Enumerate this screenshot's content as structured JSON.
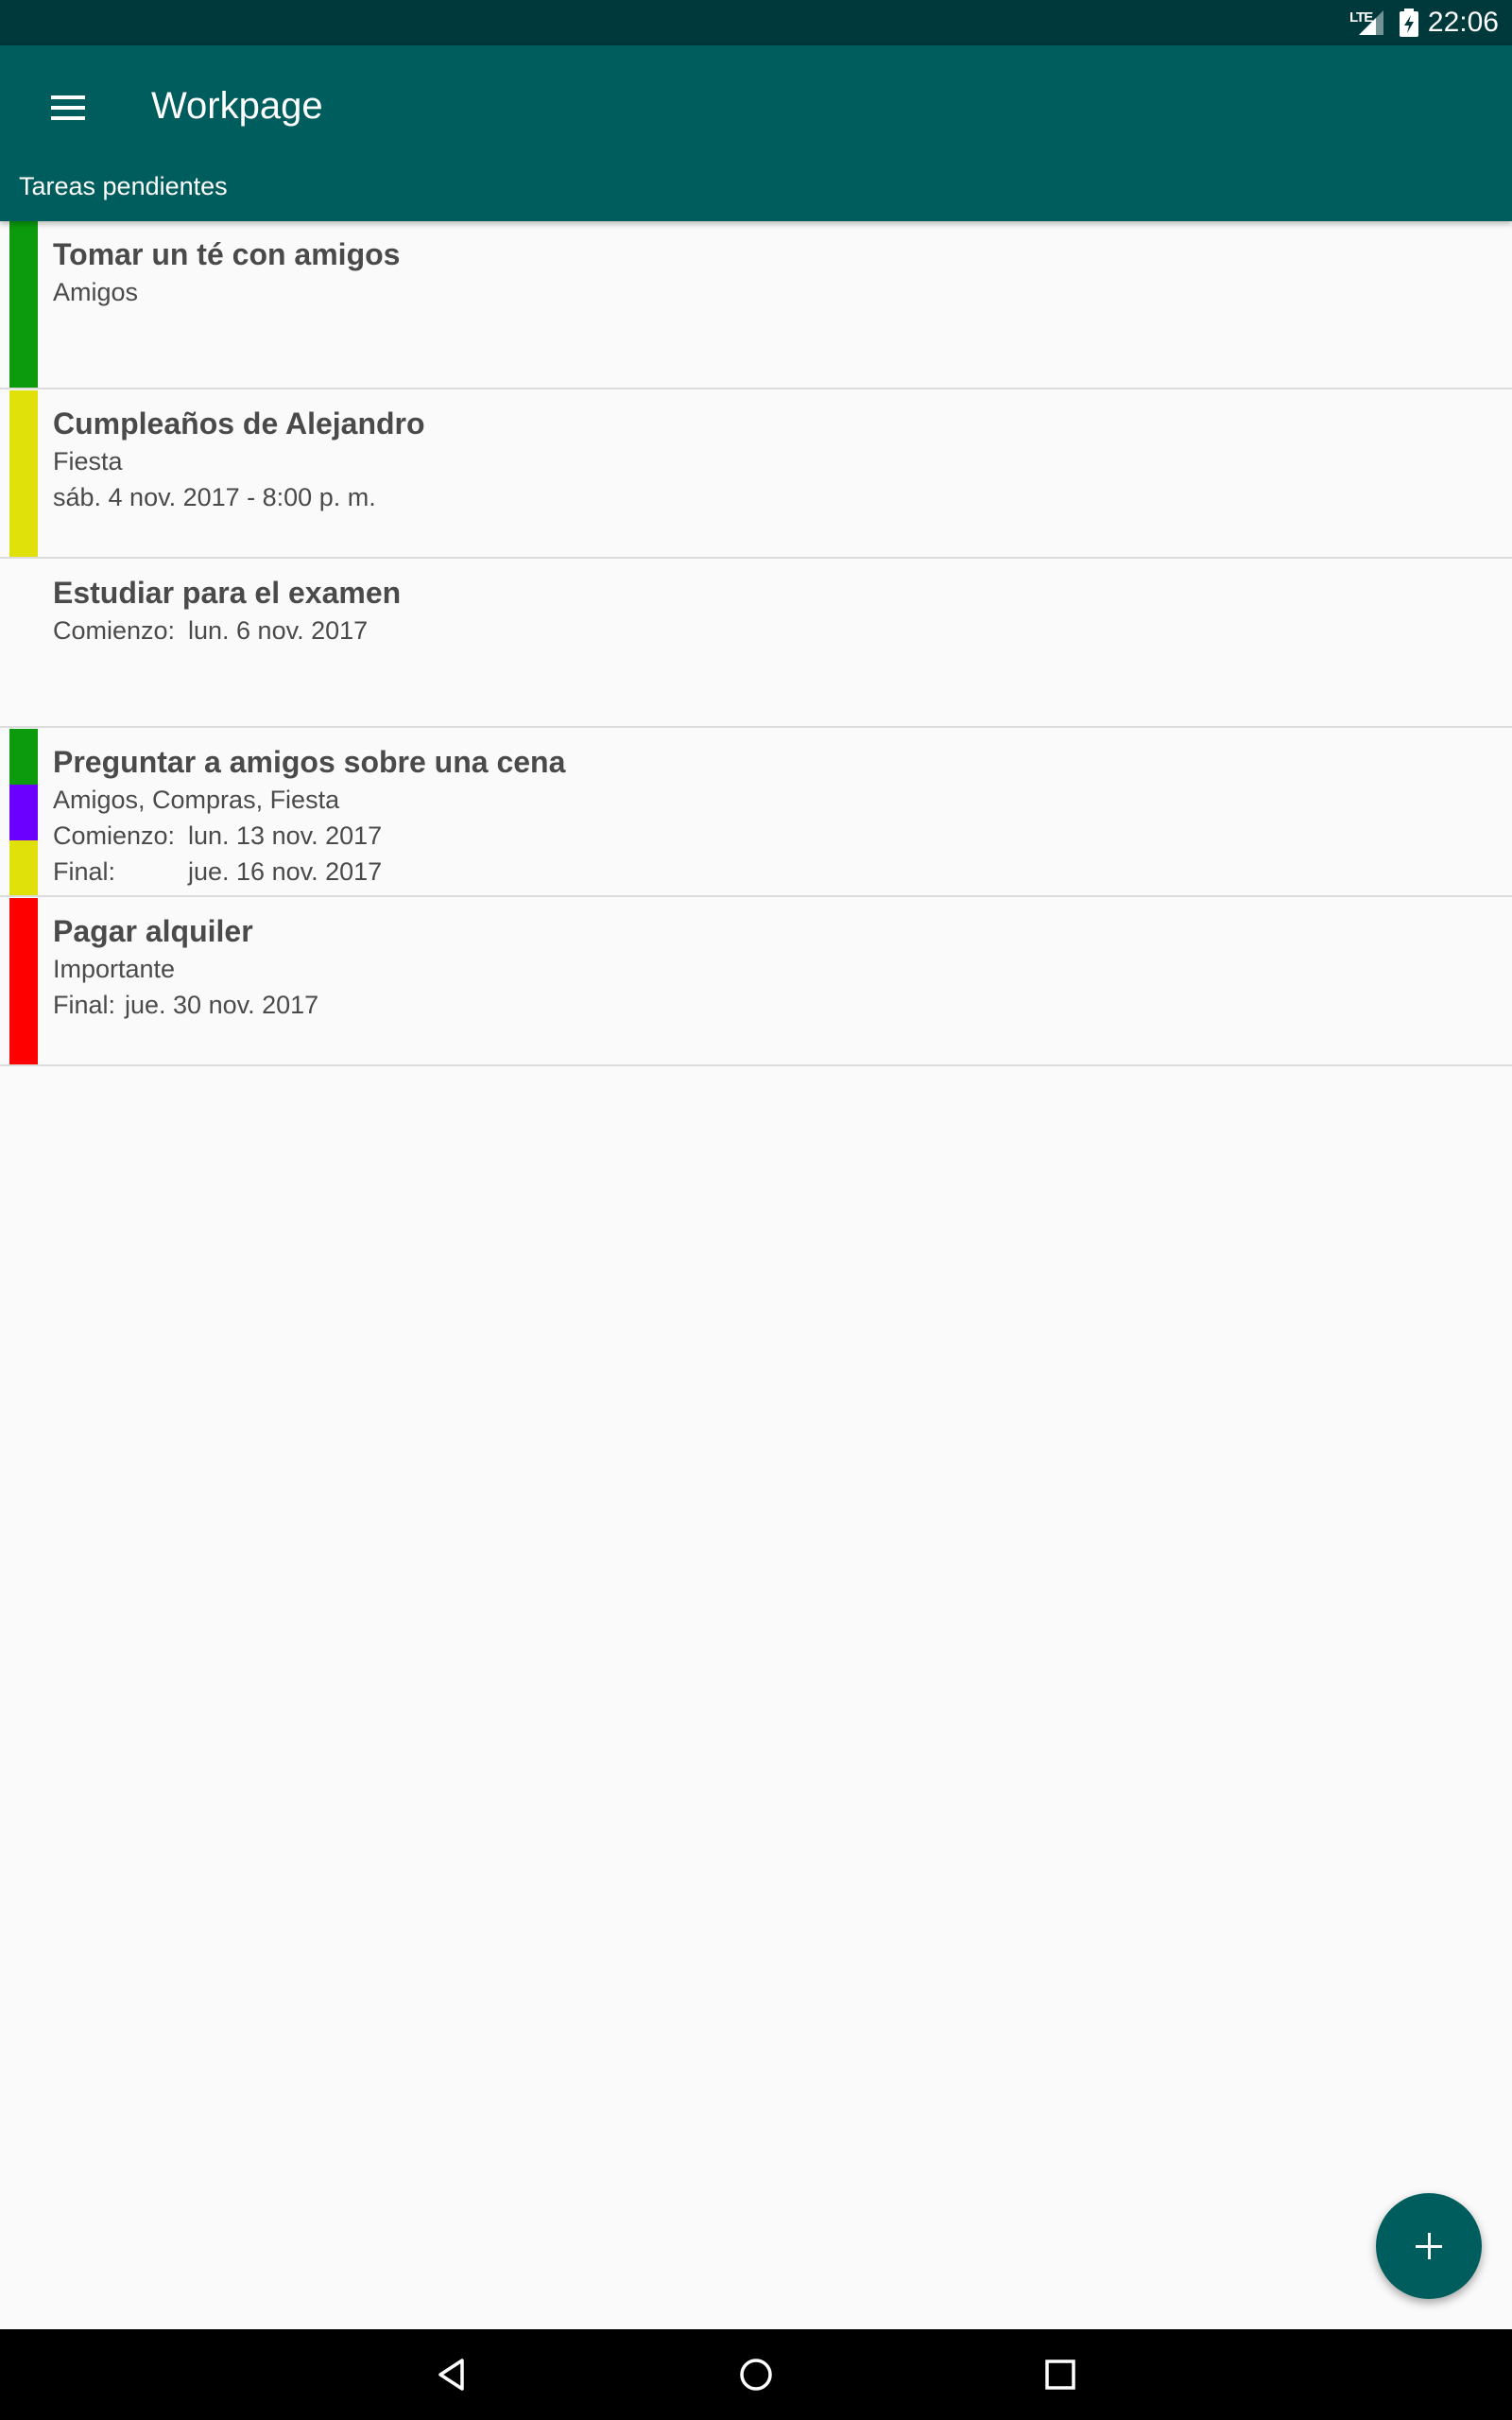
{
  "status_bar": {
    "network": "LTE",
    "time": "22:06"
  },
  "app_bar": {
    "title": "Workpage",
    "subtitle": "Tareas pendientes"
  },
  "tasks": [
    {
      "title": "Tomar un té con amigos",
      "categories": "Amigos",
      "colors": [
        "#0c9b0c"
      ]
    },
    {
      "title": "Cumpleaños de Alejandro",
      "categories": "Fiesta",
      "datetime": "sáb. 4 nov. 2017 - 8:00 p. m.",
      "colors": [
        "#e0e00a"
      ]
    },
    {
      "title": "Estudiar para el examen",
      "start_label": "Comienzo:",
      "start_value": "lun. 6 nov. 2017",
      "colors": []
    },
    {
      "title": "Preguntar a amigos sobre una cena",
      "categories": "Amigos, Compras, Fiesta",
      "start_label": "Comienzo:",
      "start_value": "lun. 13 nov. 2017",
      "end_label": "Final:",
      "end_value": "jue. 16 nov. 2017",
      "colors": [
        "#0c9b0c",
        "#6b00ff",
        "#e0e00a"
      ]
    },
    {
      "title": "Pagar alquiler",
      "categories": "Importante",
      "end_label": "Final:",
      "end_value": "jue. 30 nov. 2017",
      "colors": [
        "#ff0000"
      ]
    }
  ],
  "fab": {
    "icon": "plus-icon"
  },
  "nav_bar": {
    "icons": [
      "back-icon",
      "home-icon",
      "recents-icon"
    ]
  },
  "theme": {
    "primary": "#005d5d",
    "status_bar": "#00393b"
  }
}
